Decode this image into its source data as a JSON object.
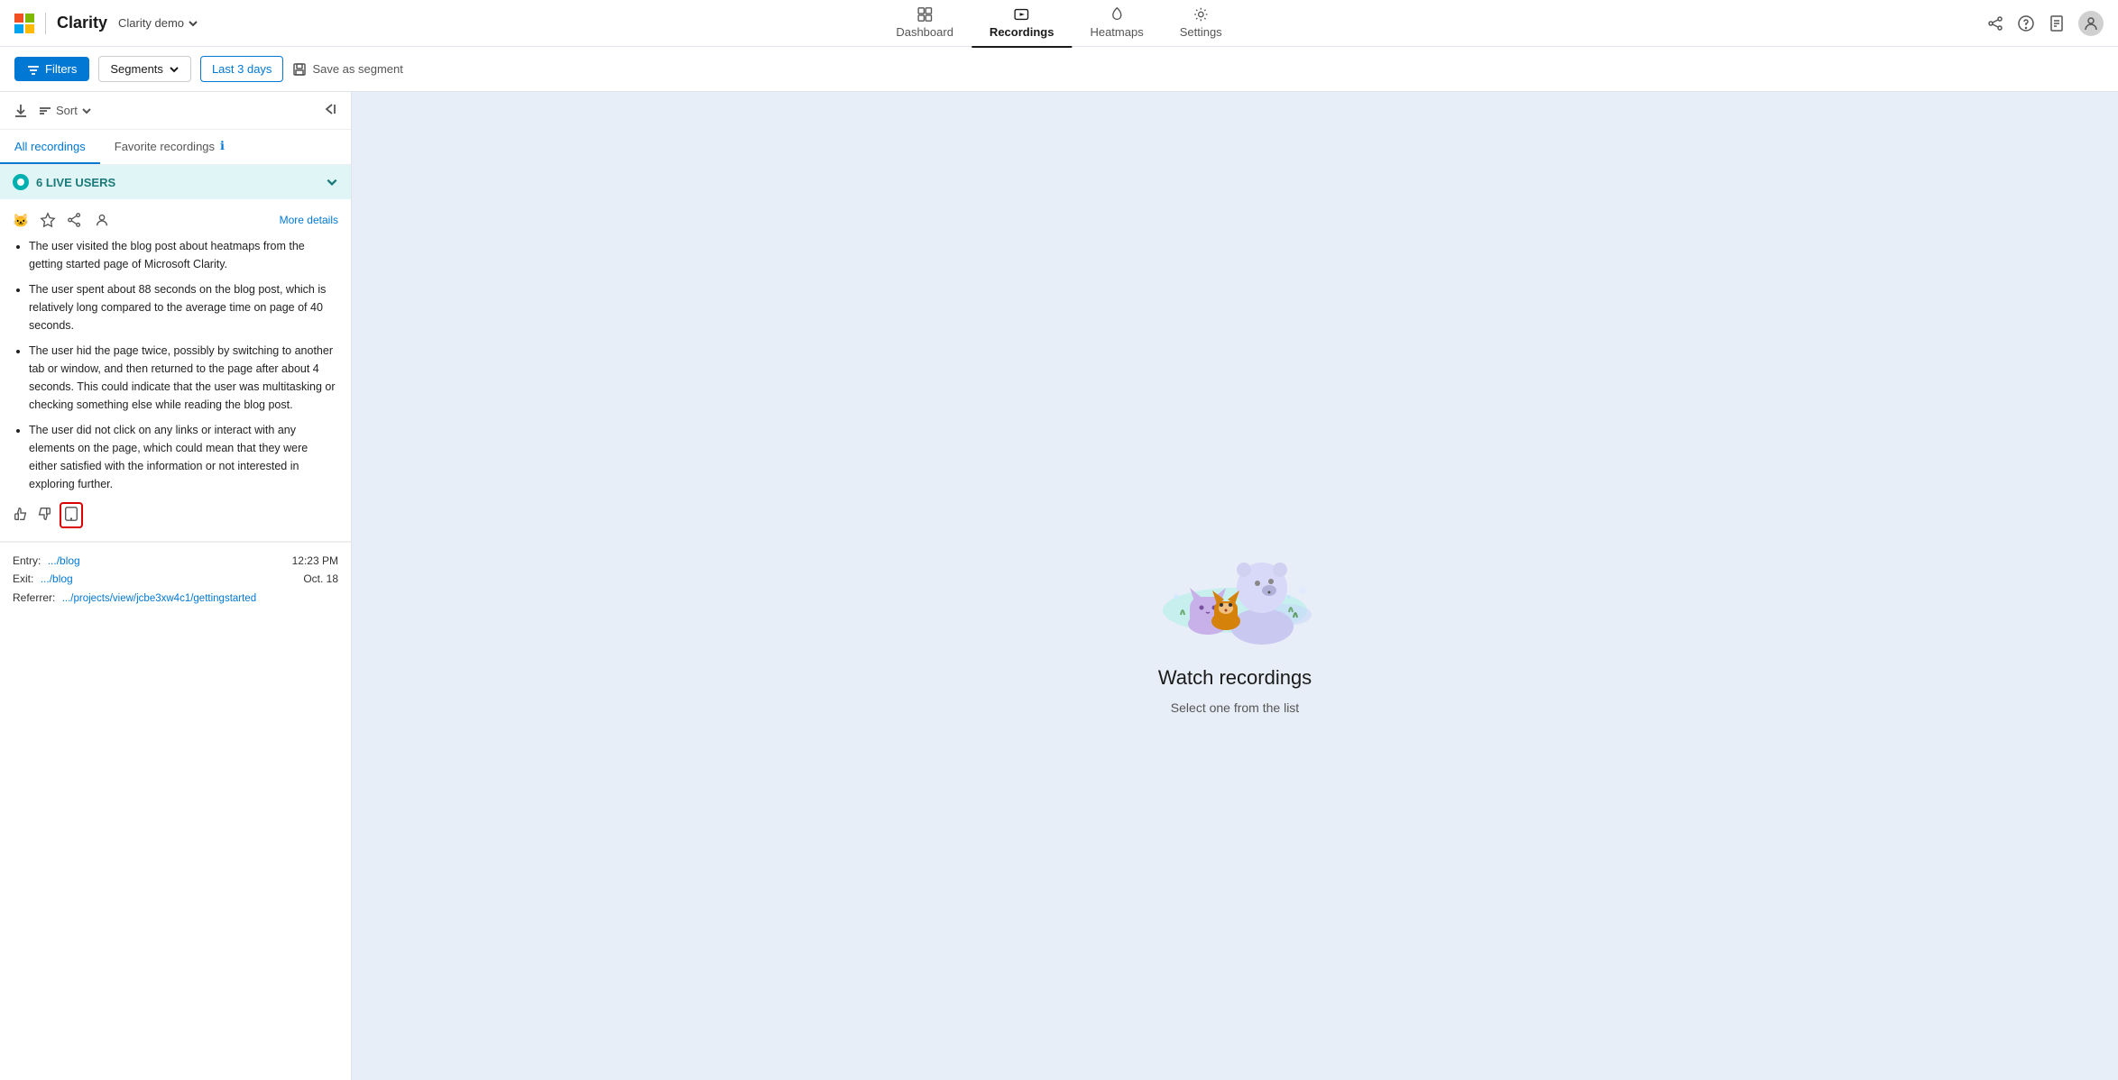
{
  "brand": {
    "ms_label": "Microsoft",
    "clarity_label": "Clarity",
    "project": "Clarity demo"
  },
  "nav": {
    "items": [
      {
        "id": "dashboard",
        "label": "Dashboard",
        "active": false
      },
      {
        "id": "recordings",
        "label": "Recordings",
        "active": true
      },
      {
        "id": "heatmaps",
        "label": "Heatmaps",
        "active": false
      },
      {
        "id": "settings",
        "label": "Settings",
        "active": false
      }
    ]
  },
  "toolbar": {
    "filters_label": "Filters",
    "segments_label": "Segments",
    "days_label": "Last 3 days",
    "save_label": "Save as segment"
  },
  "sidebar": {
    "sort_label": "Sort",
    "tabs": [
      {
        "id": "all",
        "label": "All recordings",
        "active": true
      },
      {
        "id": "favorite",
        "label": "Favorite recordings",
        "badge": "ℹ",
        "active": false
      }
    ],
    "live_users": {
      "label": "6 LIVE USERS"
    },
    "recording": {
      "more_details": "More details",
      "bullets": [
        "The user visited the blog post about heatmaps from the getting started page of Microsoft Clarity.",
        "The user spent about 88 seconds on the blog post, which is relatively long compared to the average time on page of 40 seconds.",
        "The user hid the page twice, possibly by switching to another tab or window, and then returned to the page after about 4 seconds. This could indicate that the user was multitasking or checking something else while reading the blog post.",
        "The user did not click on any links or interact with any elements on the page, which could mean that they were either satisfied with the information or not interested in exploring further."
      ],
      "meta": {
        "entry_label": "Entry:",
        "entry_value": ".../blog",
        "exit_label": "Exit:",
        "exit_value": ".../blog",
        "referrer_label": "Referrer:",
        "referrer_value": ".../projects/view/jcbe3xw4c1/gettingstarted",
        "time": "12:23 PM",
        "date": "Oct. 18"
      }
    }
  },
  "watch_panel": {
    "title": "Watch recordings",
    "subtitle": "Select one from the list"
  }
}
